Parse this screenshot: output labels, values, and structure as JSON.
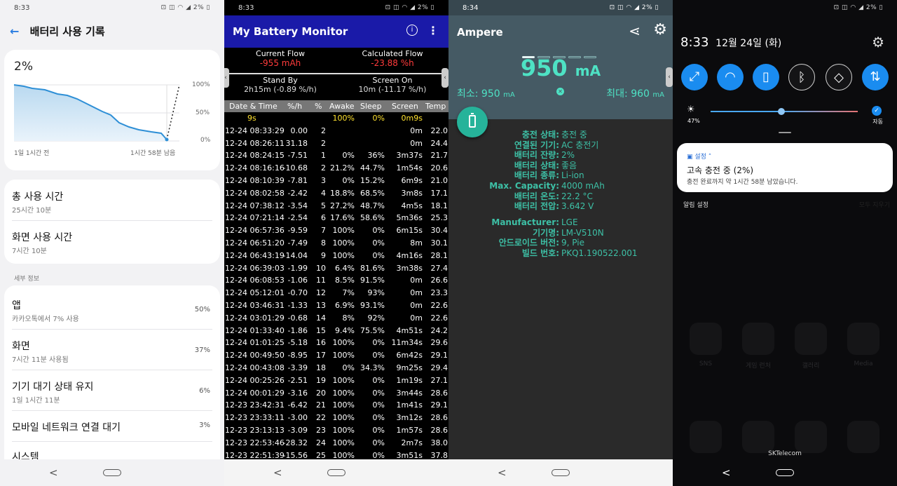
{
  "panel1": {
    "status": {
      "time": "8:33",
      "icons": "⊡ ◫ ◠ ◢ 2% ▯"
    },
    "title": "배터리 사용 기록",
    "graph": {
      "percent": "2%",
      "y_labels": [
        "100%",
        "50%",
        "0%"
      ],
      "x_left": "1일 1시간 전",
      "x_right": "1시간 58분 남음"
    },
    "usage": [
      {
        "label": "총 사용 시간",
        "value": "25시간 10분"
      },
      {
        "label": "화면 사용 시간",
        "value": "7시간 10분"
      }
    ],
    "section": "세부 정보",
    "details": [
      {
        "label": "앱",
        "sub": "카카오톡에서 7% 사용",
        "pct": "50%"
      },
      {
        "label": "화면",
        "sub": "7시간 11분 사용됨",
        "pct": "37%"
      },
      {
        "label": "기기 대기 상태 유지",
        "sub": "1일 1시간 11분",
        "pct": "6%"
      },
      {
        "label": "모바일 네트워크 연결 대기",
        "sub": "",
        "pct": "3%"
      },
      {
        "label": "시스템",
        "sub": "",
        "pct": "2%"
      }
    ]
  },
  "panel2": {
    "status": {
      "time": "8:33",
      "icons": "⊡ ◫ ◠ ◢ 2% ▯"
    },
    "title": "My Battery Monitor",
    "current_flow_label": "Current Flow",
    "current_flow": "-955 mAh",
    "calc_flow_label": "Calculated Flow",
    "calc_flow": "-23.88 %h",
    "standby_label": "Stand By",
    "standby": "2h15m (-0.89 %/h)",
    "screen_on_label": "Screen On",
    "screen_on": "10m (-11.17 %/h)",
    "columns": [
      "Date & Time",
      "%/h",
      "%",
      "Awake",
      "Sleep",
      "Screen",
      "Temp"
    ],
    "rows": [
      [
        "9s",
        "",
        "",
        "100%",
        "0%",
        "0m9s",
        ""
      ],
      [
        "12-24 08:33:29",
        "0.00",
        "2",
        "",
        "",
        "0m",
        "22.0"
      ],
      [
        "12-24 08:26:11",
        "31.18",
        "2",
        "",
        "",
        "0m",
        "24.4"
      ],
      [
        "12-24 08:24:15",
        "-7.51",
        "1",
        "0%",
        "36%",
        "3m37s",
        "21.7"
      ],
      [
        "12-24 08:16:16",
        "-10.68",
        "2",
        "21.2%",
        "44.7%",
        "1m54s",
        "20.6"
      ],
      [
        "12-24 08:10:39",
        "-7.81",
        "3",
        "0%",
        "15.2%",
        "6m9s",
        "21.0"
      ],
      [
        "12-24 08:02:58",
        "-2.42",
        "4",
        "18.8%",
        "68.5%",
        "3m8s",
        "17.1"
      ],
      [
        "12-24 07:38:12",
        "-3.54",
        "5",
        "27.2%",
        "48.7%",
        "4m5s",
        "18.1"
      ],
      [
        "12-24 07:21:14",
        "-2.54",
        "6",
        "17.6%",
        "58.6%",
        "5m36s",
        "25.3"
      ],
      [
        "12-24 06:57:36",
        "-9.59",
        "7",
        "100%",
        "0%",
        "6m15s",
        "30.4"
      ],
      [
        "12-24 06:51:20",
        "-7.49",
        "8",
        "100%",
        "0%",
        "8m",
        "30.1"
      ],
      [
        "12-24 06:43:19",
        "-14.04",
        "9",
        "100%",
        "0%",
        "4m16s",
        "28.1"
      ],
      [
        "12-24 06:39:03",
        "-1.99",
        "10",
        "6.4%",
        "81.6%",
        "3m38s",
        "27.4"
      ],
      [
        "12-24 06:08:53",
        "-1.06",
        "11",
        "8.5%",
        "91.5%",
        "0m",
        "26.6"
      ],
      [
        "12-24 05:12:01",
        "-0.70",
        "12",
        "7%",
        "93%",
        "0m",
        "23.3"
      ],
      [
        "12-24 03:46:31",
        "-1.33",
        "13",
        "6.9%",
        "93.1%",
        "0m",
        "22.6"
      ],
      [
        "12-24 03:01:29",
        "-0.68",
        "14",
        "8%",
        "92%",
        "0m",
        "22.6"
      ],
      [
        "12-24 01:33:40",
        "-1.86",
        "15",
        "9.4%",
        "75.5%",
        "4m51s",
        "24.2"
      ],
      [
        "12-24 01:01:25",
        "-5.18",
        "16",
        "100%",
        "0%",
        "11m34s",
        "29.6"
      ],
      [
        "12-24 00:49:50",
        "-8.95",
        "17",
        "100%",
        "0%",
        "6m42s",
        "29.1"
      ],
      [
        "12-24 00:43:08",
        "-3.39",
        "18",
        "0%",
        "34.3%",
        "9m25s",
        "29.4"
      ],
      [
        "12-24 00:25:26",
        "-2.51",
        "19",
        "100%",
        "0%",
        "1m19s",
        "27.1"
      ],
      [
        "12-24 00:01:29",
        "-3.16",
        "20",
        "100%",
        "0%",
        "3m44s",
        "28.6"
      ],
      [
        "12-23 23:42:31",
        "-6.42",
        "21",
        "100%",
        "0%",
        "1m41s",
        "29.1"
      ],
      [
        "12-23 23:33:11",
        "-3.00",
        "22",
        "100%",
        "0%",
        "3m12s",
        "28.6"
      ],
      [
        "12-23 23:13:13",
        "-3.09",
        "23",
        "100%",
        "0%",
        "1m57s",
        "28.6"
      ],
      [
        "12-23 22:53:46",
        "-28.32",
        "24",
        "100%",
        "0%",
        "2m7s",
        "38.0"
      ],
      [
        "12-23 22:51:39",
        "-15.56",
        "25",
        "100%",
        "0%",
        "3m51s",
        "37.8"
      ]
    ]
  },
  "panel3": {
    "status": {
      "time": "8:34",
      "icons": "⊡ ◫ ◠ ◢ 2% ▯"
    },
    "title": "Ampere",
    "value": "950",
    "unit": "mA",
    "min": "최소: 950",
    "max": "최대: 960",
    "min_unit": "mA",
    "max_unit": "mA",
    "info": [
      {
        "label": "충전 상태:",
        "value": "충전 중"
      },
      {
        "label": "연결된 기기:",
        "value": "AC 충전기"
      },
      {
        "label": "배터리 잔량:",
        "value": "2%"
      },
      {
        "label": "배터리 상태:",
        "value": "좋음"
      },
      {
        "label": "배터리 종류:",
        "value": "Li-ion"
      },
      {
        "label": "Max. Capacity:",
        "value": "4000 mAh"
      },
      {
        "label": "배터리 온도:",
        "value": "22.2 °C"
      },
      {
        "label": "배터리 전압:",
        "value": "3.642 V"
      }
    ],
    "info2": [
      {
        "label": "Manufacturer:",
        "value": "LGE"
      },
      {
        "label": "기기명:",
        "value": "LM-V510N"
      },
      {
        "label": "안드로이드 버전:",
        "value": "9, Pie"
      },
      {
        "label": "빌드 번호:",
        "value": "PKQ1.190522.001"
      }
    ],
    "accent": "#4ee2c4"
  },
  "panel4": {
    "status": {
      "icons": "⊡ ◫ ◠ ◢ 2% ▯"
    },
    "time": "8:33",
    "date": "12월 24일 (화)",
    "brightness": {
      "label": "47%",
      "auto": "자동",
      "level": 0.48
    },
    "notification": {
      "app": "설정 ˄",
      "title": "고속 충전 중 (2%)",
      "text": "충전 완료까지 약 1시간 58분 남았습니다."
    },
    "notif_settings": "알림 설정",
    "clear_all": "모두 지우기",
    "carrier": "SKTelecom",
    "bg_apps": [
      "SNS",
      "게임 런처",
      "갤러리",
      "Media"
    ]
  }
}
